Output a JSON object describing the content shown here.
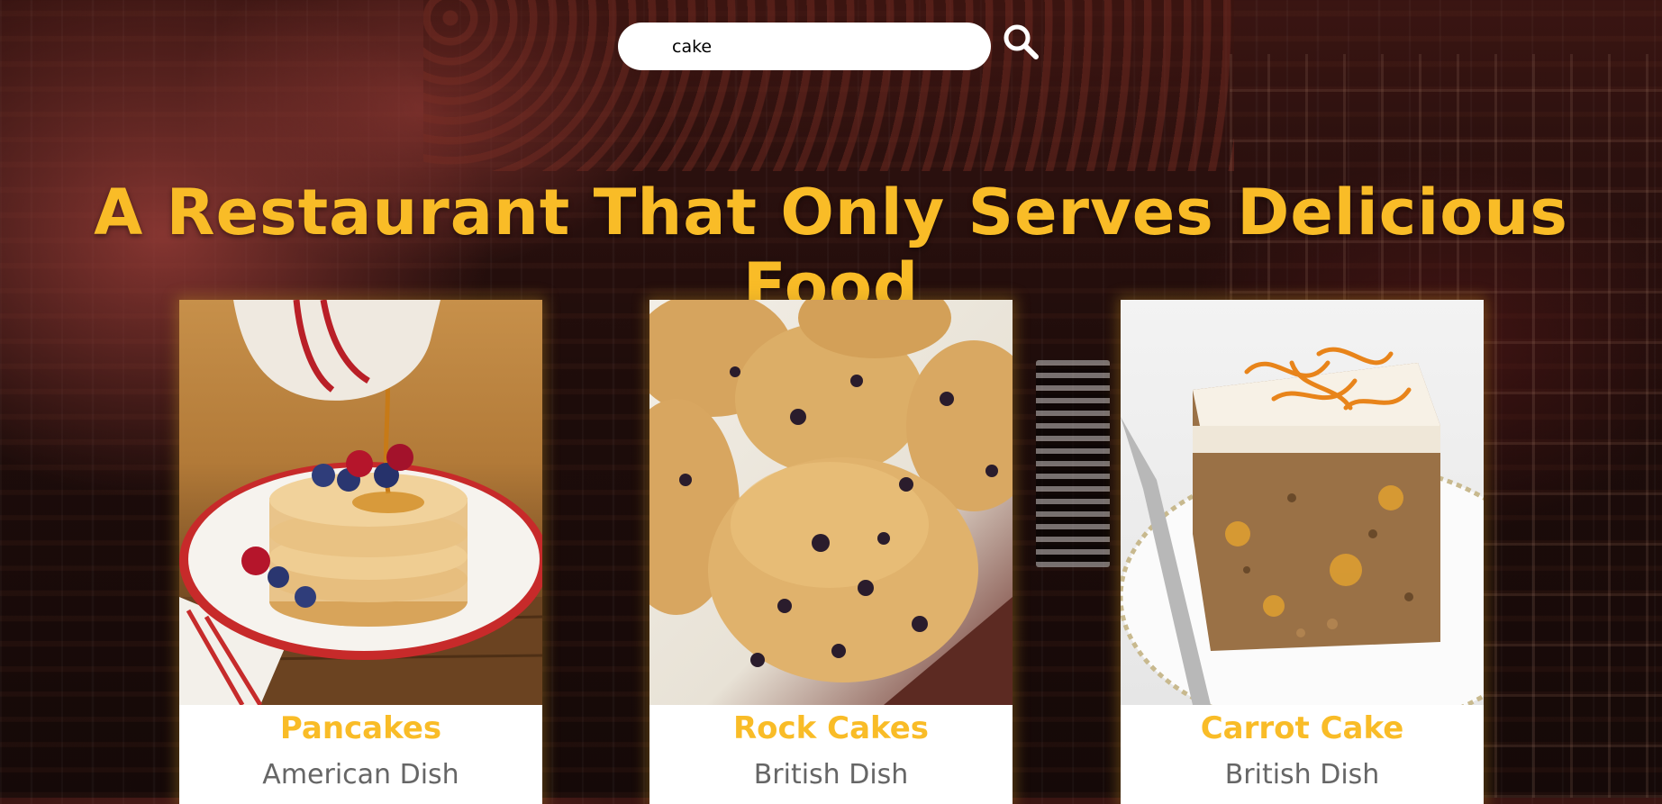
{
  "search": {
    "value": "cake",
    "placeholder": ""
  },
  "headline": "A Restaurant That Only Serves Delicious Food",
  "colors": {
    "accent": "#f9bc27",
    "card_background": "#ffffff",
    "subtitle": "#666666"
  },
  "icons": {
    "search": "magnifying-glass-icon"
  },
  "dishes": [
    {
      "name": "Pancakes",
      "cuisine": "American Dish",
      "photo": "pancakes-photo"
    },
    {
      "name": "Rock Cakes",
      "cuisine": "British Dish",
      "photo": "rock-cakes-photo"
    },
    {
      "name": "Carrot Cake",
      "cuisine": "British Dish",
      "photo": "carrot-cake-photo"
    }
  ]
}
